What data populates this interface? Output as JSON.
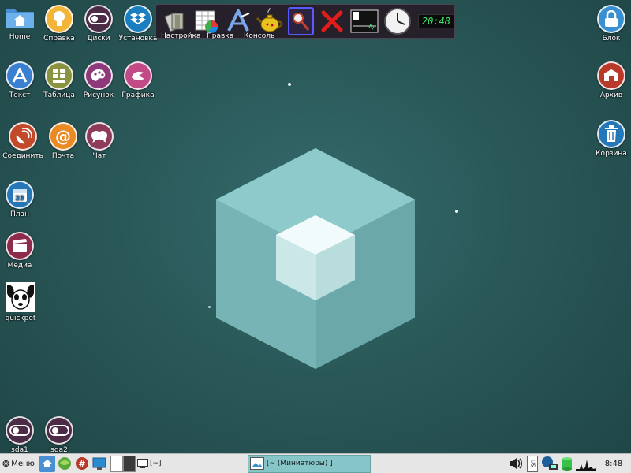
{
  "desktop_left": [
    {
      "id": "home",
      "label": "Home",
      "icon": "home-folder-icon"
    },
    {
      "id": "help",
      "label": "Справка",
      "icon": "lightbulb-icon"
    },
    {
      "id": "disks",
      "label": "Диски",
      "icon": "toggle-icon"
    },
    {
      "id": "install",
      "label": "Установка",
      "icon": "dropbox-icon"
    },
    {
      "id": "text",
      "label": "Текст",
      "icon": "text-editor-icon"
    },
    {
      "id": "table",
      "label": "Таблица",
      "icon": "spreadsheet-icon"
    },
    {
      "id": "drawing",
      "label": "Рисунок",
      "icon": "palette-icon"
    },
    {
      "id": "graphics",
      "label": "Графика",
      "icon": "graphics-icon"
    },
    {
      "id": "connect",
      "label": "Соединить",
      "icon": "satellite-dish-icon"
    },
    {
      "id": "mail",
      "label": "Почта",
      "icon": "at-sign-icon"
    },
    {
      "id": "chat",
      "label": "Чат",
      "icon": "chat-icon"
    },
    {
      "id": "plan",
      "label": "План",
      "icon": "calendar-icon"
    },
    {
      "id": "media",
      "label": "Медиа",
      "icon": "clapperboard-icon"
    },
    {
      "id": "quickpet",
      "label": "quickpet",
      "icon": "dog-icon"
    },
    {
      "id": "sda1",
      "label": "sda1",
      "icon": "drive-toggle-icon"
    },
    {
      "id": "sda2",
      "label": "sda2",
      "icon": "drive-toggle-icon"
    }
  ],
  "desktop_right": [
    {
      "id": "lock",
      "label": "Блок",
      "icon": "padlock-icon"
    },
    {
      "id": "archive",
      "label": "Архив",
      "icon": "archive-icon"
    },
    {
      "id": "trash",
      "label": "Корзина",
      "icon": "trash-icon"
    }
  ],
  "dock": {
    "partial_labels": [
      "Настройка",
      "Правка",
      "Консоль"
    ],
    "digital_time": "20:48",
    "items": [
      "files-icon",
      "spreadsheet-chart-icon",
      "text-editor-icon",
      "teapot-icon",
      "search-magnifier-icon",
      "close-x-icon",
      "monitor-icon",
      "analog-clock-icon"
    ]
  },
  "taskbar": {
    "menu_label": "Меню",
    "console_task": "[~]",
    "active_task": "[~ (Миниатюры) ]",
    "tray_lang": "US",
    "clock": "8:48"
  },
  "colors": {
    "desktop_bg": "#2a5858",
    "taskbar_bg": "#e6e6e6",
    "active_task_bg": "#86c5c8",
    "dock_bg": "#26202a",
    "digital_clock": "#39e86a"
  }
}
